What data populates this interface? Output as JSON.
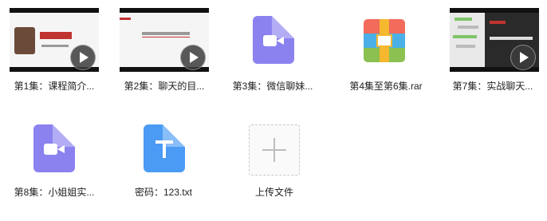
{
  "files": [
    {
      "label": "第1集：课程简介..."
    },
    {
      "label": "第2集：聊天的目..."
    },
    {
      "label": "第3集：微信聊妹..."
    },
    {
      "label": "第4集至第6集.rar"
    },
    {
      "label": "第7集：实战聊天..."
    },
    {
      "label": "第8集：小姐姐实..."
    },
    {
      "label": "密码：123.txt"
    },
    {
      "label": "上传文件"
    }
  ],
  "colors": {
    "video_icon": "#8b82f0",
    "txt_icon": "#4b9bf5"
  },
  "icons": {
    "video": "video-file-icon",
    "text": "text-file-icon",
    "archive": "archive-file-icon",
    "upload": "plus-icon",
    "play": "play-icon"
  }
}
